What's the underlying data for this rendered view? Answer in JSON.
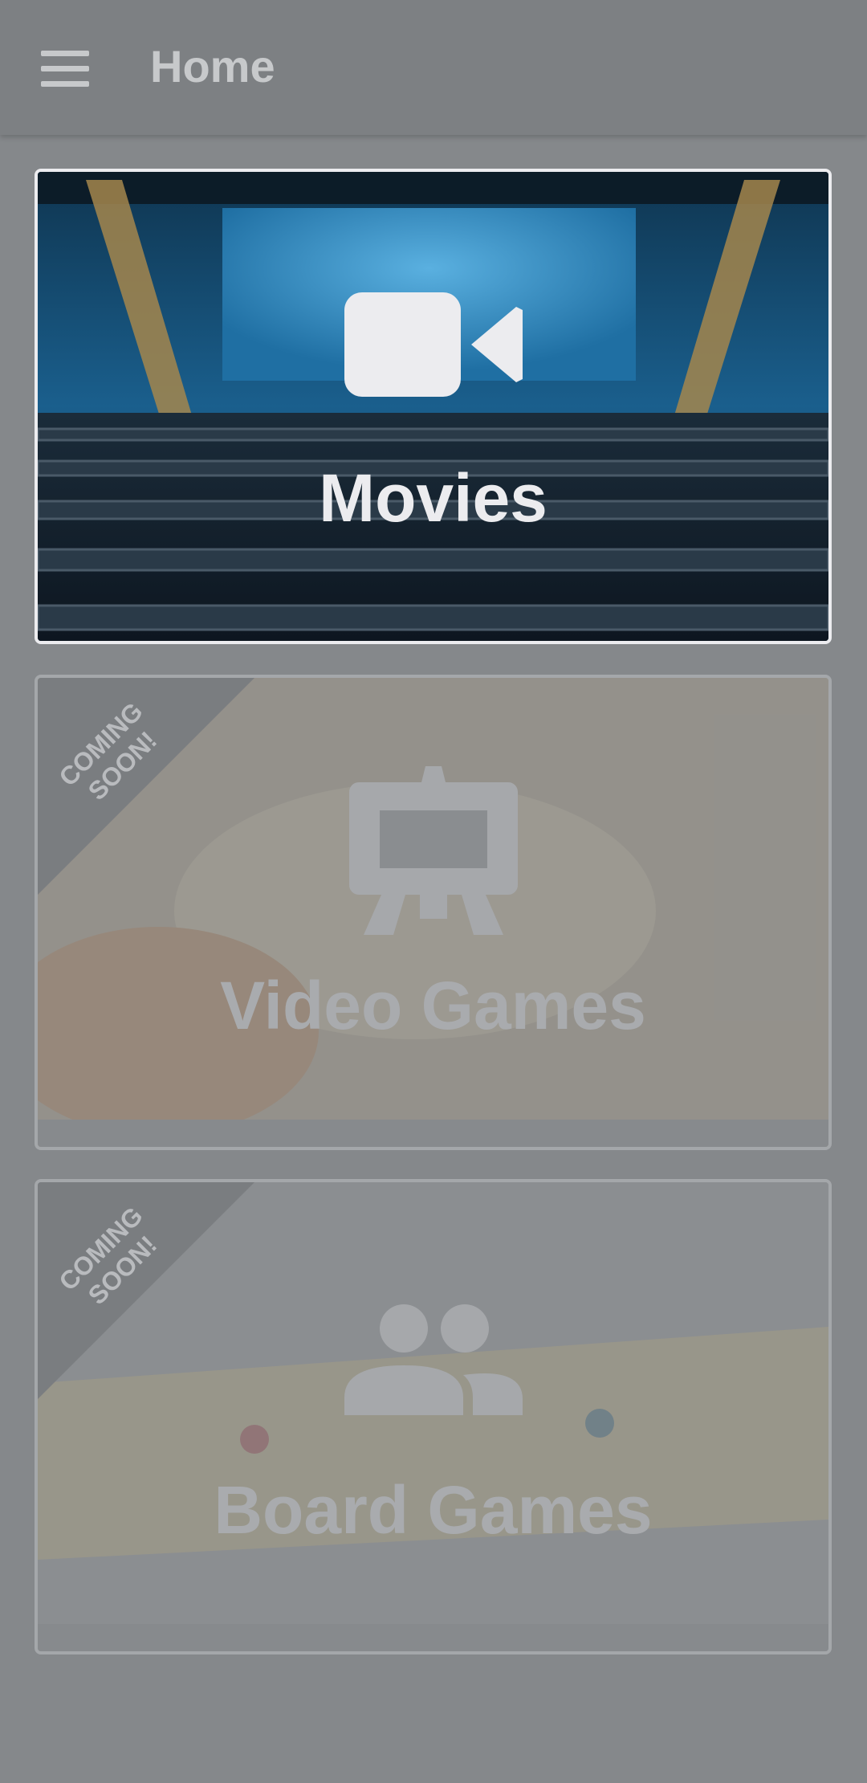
{
  "header": {
    "title": "Home",
    "menu_icon": "menu-icon"
  },
  "cards": [
    {
      "label": "Movies",
      "icon": "video-camera-icon",
      "badge": "",
      "enabled": true
    },
    {
      "label": "Video Games",
      "icon": "arcade-icon",
      "badge": "COMING SOON!",
      "enabled": false
    },
    {
      "label": "Board Games",
      "icon": "people-icon",
      "badge": "COMING SOON!",
      "enabled": false
    }
  ],
  "badge_lines": [
    "COMING",
    "SOON!"
  ],
  "colors": {
    "scrim": "#85888b",
    "active_border": "#ececef",
    "theater_blue": "#1f6fa3"
  }
}
